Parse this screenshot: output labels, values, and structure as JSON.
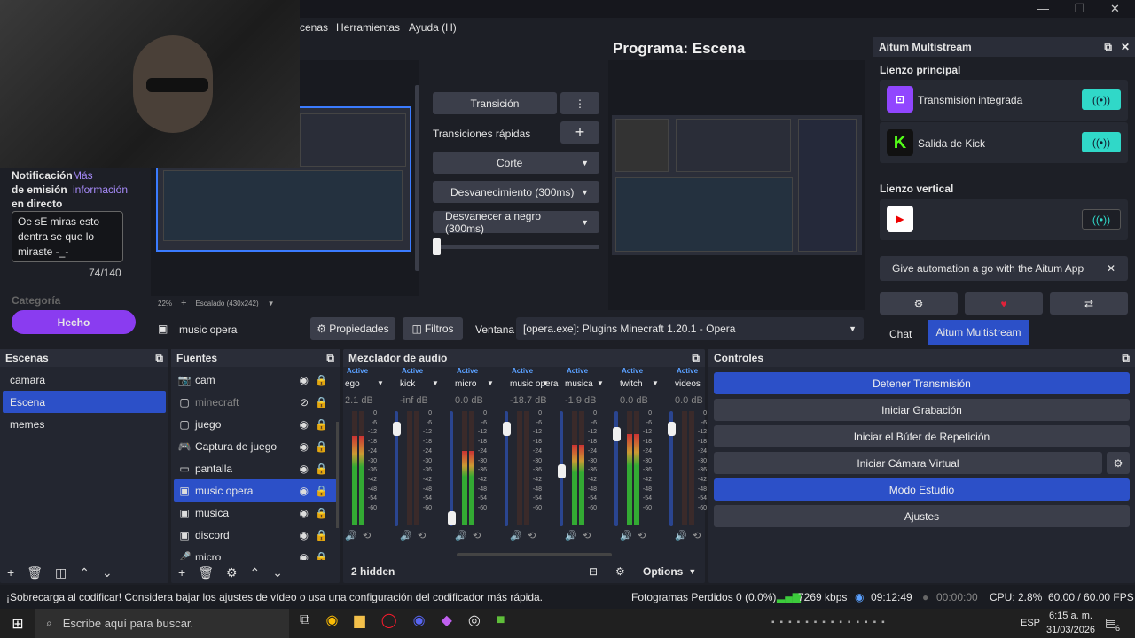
{
  "menu": {
    "items": [
      "cenas",
      "Herramientas",
      "Ayuda (H)"
    ]
  },
  "window": {
    "minimize": "—",
    "maximize": "❐",
    "close": "✕"
  },
  "program": {
    "title": "Programa: Escena"
  },
  "preview": {
    "zoom": "22%",
    "zoom_plus": "+",
    "scale_label": "Escalado (430x242)"
  },
  "transitions": {
    "transition_label": "Transición",
    "quick_label": "Transiciones rápidas",
    "items": [
      "Corte",
      "Desvanecimiento (300ms)",
      "Desvanecer a negro (300ms)"
    ]
  },
  "chat_overlay": {
    "notif_label": "Notificación de emisión en directo",
    "more_info": "Más información",
    "text": "Oe sE miras esto dentra se que lo miraste -_-",
    "counter": "74/140",
    "category": "Categoría",
    "done": "Hecho"
  },
  "source_toolbar": {
    "source_name": "music opera",
    "properties": "Propiedades",
    "filters": "Filtros",
    "window_label": "Ventana",
    "window_value": "[opera.exe]: Plugins Minecraft 1.20.1 - Opera"
  },
  "aitum": {
    "title": "Aitum Multistream",
    "main_canvas": "Lienzo principal",
    "outputs": [
      "Transmisión integrada",
      "Salida de Kick"
    ],
    "vertical_canvas": "Lienzo vertical",
    "promo": "Give automation a go with the Aitum App",
    "tabs": [
      "Chat",
      "Aitum Multistream"
    ]
  },
  "scenes": {
    "title": "Escenas",
    "items": [
      "camara",
      "Escena",
      "memes"
    ],
    "selected": 1
  },
  "sources": {
    "title": "Fuentes",
    "items": [
      {
        "name": "cam",
        "icon": "📷",
        "hidden": false
      },
      {
        "name": "minecraft",
        "icon": "▢",
        "hidden": true
      },
      {
        "name": "juego",
        "icon": "▢",
        "hidden": false
      },
      {
        "name": "Captura de juego",
        "icon": "🎮",
        "hidden": false
      },
      {
        "name": "pantalla",
        "icon": "▭",
        "hidden": false
      },
      {
        "name": "music opera",
        "icon": "▣",
        "hidden": false
      },
      {
        "name": "musica",
        "icon": "▣",
        "hidden": false
      },
      {
        "name": "discord",
        "icon": "▣",
        "hidden": false
      },
      {
        "name": "micro",
        "icon": "🎤",
        "hidden": false
      }
    ],
    "selected": 5
  },
  "mixer": {
    "title": "Mezclador de audio",
    "hidden_count": "2 hidden",
    "options": "Options",
    "channels": [
      {
        "name": "ego",
        "db": "2.1 dB",
        "level": 0.78,
        "fader": 0.9
      },
      {
        "name": "kick",
        "db": "-inf dB",
        "level": 0.0,
        "fader": 0.06
      },
      {
        "name": "micro",
        "db": "0.0 dB",
        "level": 0.65,
        "fader": 0.9
      },
      {
        "name": "music opera",
        "db": "-18.7 dB",
        "level": 0.0,
        "fader": 0.5
      },
      {
        "name": "musica",
        "db": "-1.9 dB",
        "level": 0.7,
        "fader": 0.85
      },
      {
        "name": "twitch",
        "db": "0.0 dB",
        "level": 0.8,
        "fader": 0.9
      },
      {
        "name": "videos",
        "db": "0.0 dB",
        "level": 0.0,
        "fader": 0.9
      }
    ],
    "active_label": "Active",
    "scale": [
      "0",
      "-6",
      "-12",
      "-18",
      "-24",
      "-30",
      "-36",
      "-42",
      "-48",
      "-54",
      "-60"
    ]
  },
  "controls": {
    "title": "Controles",
    "buttons": [
      "Detener Transmisión",
      "Iniciar Grabación",
      "Iniciar el Búfer de Repetición",
      "Iniciar Cámara Virtual",
      "Modo Estudio",
      "Ajustes"
    ]
  },
  "status": {
    "warning": "¡Sobrecarga al codificar! Considera bajar los ajustes de vídeo o usa una configuración del codificador más rápida.",
    "dropped": "Fotogramas Perdidos 0 (0.0%)",
    "kbps": "7269 kbps",
    "stream_time": "09:12:49",
    "rec_time": "00:00:00",
    "cpu": "CPU: 2.8%",
    "fps": "60.00 / 60.00 FPS"
  },
  "taskbar": {
    "search": "Escribe aquí para buscar.",
    "lang": "ESP",
    "time": "6:15 a. m.",
    "date": "31/03/2026",
    "notif": "6"
  }
}
